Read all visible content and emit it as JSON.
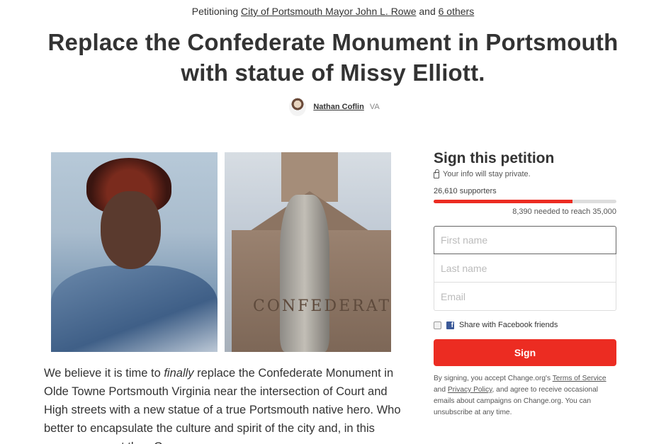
{
  "header": {
    "petitioning_prefix": "Petitioning",
    "target_link": "City of Portsmouth Mayor John L. Rowe",
    "and_text": "and",
    "others_link": "6 others"
  },
  "title": {
    "line1": "Replace the Confederate Monument in Portsmouth",
    "line2": "with statue of Missy Elliott."
  },
  "author": {
    "name": "Nathan Coflin",
    "location": "VA"
  },
  "media": {
    "right_carving": "CONFEDERATE"
  },
  "body": {
    "before_em": "We believe it is time to ",
    "em": "finally",
    "after_em": " replace the Confederate Monument in Olde Towne Portsmouth Virginia near the intersection of Court and High streets with a new statue of a true Portsmouth native hero. Who better to encapsulate the culture and spirit of the city and, in this case, represent than Ger"
  },
  "sidebar": {
    "heading": "Sign this petition",
    "private_note": "Your info will stay private.",
    "supporters": "26,610 supporters",
    "progress": 0.76,
    "goal_text": "8,390 needed to reach 35,000",
    "first_name_placeholder": "First name",
    "last_name_placeholder": "Last name",
    "email_placeholder": "Email",
    "share_label": "Share with Facebook friends",
    "sign_button": "Sign",
    "legal_prefix": "By signing, you accept Change.org's",
    "terms_link": "Terms of Service",
    "and_text": "and",
    "privacy_link": "Privacy Policy",
    "legal_suffix": ", and agree to receive occasional emails about campaigns on Change.org. You can unsubscribe at any time.",
    "accent_color": "#ec2c22",
    "facebook_color": "#3b5998"
  }
}
